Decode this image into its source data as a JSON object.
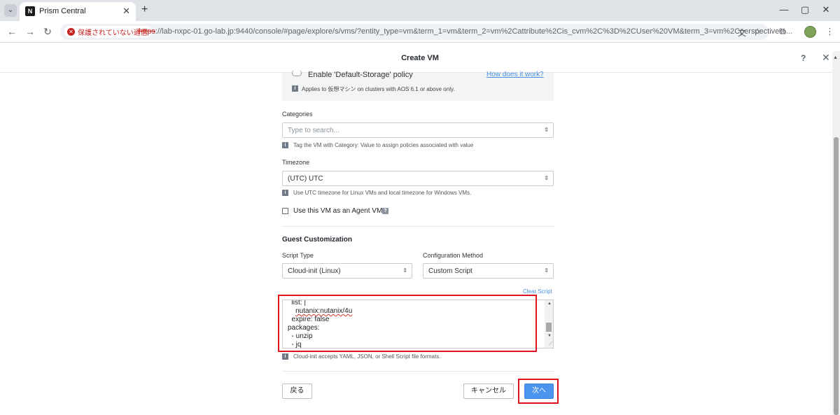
{
  "browser": {
    "tab_title": "Prism Central",
    "tab_favicon_letter": "N",
    "security_text": "保護されていない通信",
    "url_scheme": "https",
    "url_rest": "://lab-nxpc-01.go-lab.jp:9440/console/#page/explore/s/vms/?entity_type=vm&term_1=vm&term_2=vm%2Cattribute%2Cis_cvm%2C%3D%2CUser%20VM&term_3=vm%2Cperspective%..."
  },
  "dialog": {
    "title": "Create VM",
    "help_label": "?",
    "close_label": "✕"
  },
  "storage_policy": {
    "label": "Enable 'Default-Storage' policy",
    "link": "How does it work?",
    "note": "Applies to 仮想マシン on clusters with AOS 6.1 or above only."
  },
  "categories": {
    "label": "Categories",
    "placeholder": "Type to search...",
    "hint": "Tag the VM with Category: Value to assign policies associated with value"
  },
  "timezone": {
    "label": "Timezone",
    "value": "(UTC) UTC",
    "hint": "Use UTC timezone for Linux VMs and local timezone for Windows VMs."
  },
  "agent_vm": {
    "label": "Use this VM as an Agent VM",
    "help": "?",
    "checked": false
  },
  "guest_customization": {
    "title": "Guest Customization",
    "script_type_label": "Script Type",
    "script_type_value": "Cloud-init (Linux)",
    "config_method_label": "Configuration Method",
    "config_method_value": "Custom Script",
    "clear_script": "Clear Script",
    "script_lines": [
      "  list: |",
      "    nutanix:nutanix/4u",
      "  expire: false",
      "packages:",
      "  - unzip",
      "  - jq"
    ],
    "script_misspelled_word": "nutanix:nutanix/4u",
    "hint": "Cloud-init accepts YAML, JSON, or Shell Script file formats."
  },
  "footer": {
    "back": "戻る",
    "cancel": "キャンセル",
    "next": "次へ"
  },
  "icons": {
    "info": "i",
    "caret": "⇕"
  },
  "colors": {
    "primary": "#4c95ee",
    "highlight": "#e0121d",
    "link": "#4a90e2",
    "insecure": "#c5221f"
  }
}
